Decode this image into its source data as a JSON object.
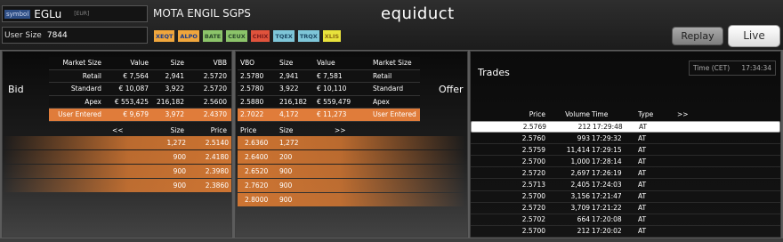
{
  "header": {
    "symbol_label": "symbol",
    "symbol": "EGLu",
    "currency": "[EUR]",
    "company": "MOTA ENGIL SGPS",
    "logo": "equiduct",
    "user_size_label": "User Size",
    "user_size": "7844",
    "venues": [
      {
        "code": "XEQT",
        "bg": "#f0a63c",
        "fg": "#1b3a8a"
      },
      {
        "code": "ALPO",
        "bg": "#f0a63c",
        "fg": "#1b3a8a"
      },
      {
        "code": "BATE",
        "bg": "#8cc46a",
        "fg": "#2a4a2a"
      },
      {
        "code": "CEUX",
        "bg": "#8cc46a",
        "fg": "#2a4a2a"
      },
      {
        "code": "CHIX",
        "bg": "#e0533c",
        "fg": "#7a1a1a"
      },
      {
        "code": "TQEX",
        "bg": "#7ec6d8",
        "fg": "#1c4a66"
      },
      {
        "code": "TRQX",
        "bg": "#7ec6d8",
        "fg": "#1c4a66"
      },
      {
        "code": "XLIS",
        "bg": "#e8e23c",
        "fg": "#8a6a10"
      }
    ],
    "replay_label": "Replay",
    "live_label": "Live"
  },
  "bid": {
    "side_label": "Bid",
    "summary_headers": [
      "Market Size",
      "Value",
      "Size",
      "VBB"
    ],
    "summary_rows": [
      {
        "name": "Retail",
        "value": "€ 7,564",
        "size": "2,941",
        "price": "2.5720"
      },
      {
        "name": "Standard",
        "value": "€ 10,087",
        "size": "3,922",
        "price": "2.5720"
      },
      {
        "name": "Apex",
        "value": "€ 553,425",
        "size": "216,182",
        "price": "2.5600"
      },
      {
        "name": "User Entered",
        "value": "€ 9,679",
        "size": "3,972",
        "price": "2.4370"
      }
    ],
    "book_headers": {
      "nav": "<<",
      "size": "Size",
      "price": "Price"
    },
    "depth": [
      {
        "size": "1,272",
        "price": "2.5140"
      },
      {
        "size": "900",
        "price": "2.4180"
      },
      {
        "size": "900",
        "price": "2.3980"
      },
      {
        "size": "900",
        "price": "2.3860"
      }
    ]
  },
  "offer": {
    "side_label": "Offer",
    "summary_headers": [
      "VBO",
      "Size",
      "Value",
      "Market Size"
    ],
    "summary_rows": [
      {
        "price": "2.5780",
        "size": "2,941",
        "value": "€ 7,581",
        "name": "Retail"
      },
      {
        "price": "2.5780",
        "size": "3,922",
        "value": "€ 10,110",
        "name": "Standard"
      },
      {
        "price": "2.5880",
        "size": "216,182",
        "value": "€ 559,479",
        "name": "Apex"
      },
      {
        "price": "2.7022",
        "size": "4,172",
        "value": "€ 11,273",
        "name": "User Entered"
      }
    ],
    "book_headers": {
      "price": "Price",
      "size": "Size",
      "nav": ">>"
    },
    "depth": [
      {
        "price": "2.6360",
        "size": "1,272"
      },
      {
        "price": "2.6400",
        "size": "200"
      },
      {
        "price": "2.6520",
        "size": "900"
      },
      {
        "price": "2.7620",
        "size": "900"
      },
      {
        "price": "2.8000",
        "size": "900"
      }
    ]
  },
  "trades": {
    "title": "Trades",
    "time_label": "Time (CET)",
    "time_value": "17:34:34",
    "headers": {
      "price": "Price",
      "volume": "Volume",
      "time": "Time",
      "type": "Type",
      "nav": ">>"
    },
    "rows": [
      {
        "price": "2.5769",
        "volume": "212",
        "time": "17:29:48",
        "type": "AT"
      },
      {
        "price": "2.5760",
        "volume": "993",
        "time": "17:29:32",
        "type": "AT"
      },
      {
        "price": "2.5759",
        "volume": "11,414",
        "time": "17:29:15",
        "type": "AT"
      },
      {
        "price": "2.5700",
        "volume": "1,000",
        "time": "17:28:14",
        "type": "AT"
      },
      {
        "price": "2.5720",
        "volume": "2,697",
        "time": "17:26:19",
        "type": "AT"
      },
      {
        "price": "2.5713",
        "volume": "2,405",
        "time": "17:24:03",
        "type": "AT"
      },
      {
        "price": "2.5700",
        "volume": "3,156",
        "time": "17:21:47",
        "type": "AT"
      },
      {
        "price": "2.5720",
        "volume": "3,709",
        "time": "17:21:22",
        "type": "AT"
      },
      {
        "price": "2.5702",
        "volume": "664",
        "time": "17:20:08",
        "type": "AT"
      },
      {
        "price": "2.5700",
        "volume": "212",
        "time": "17:20:02",
        "type": "AT"
      }
    ]
  }
}
